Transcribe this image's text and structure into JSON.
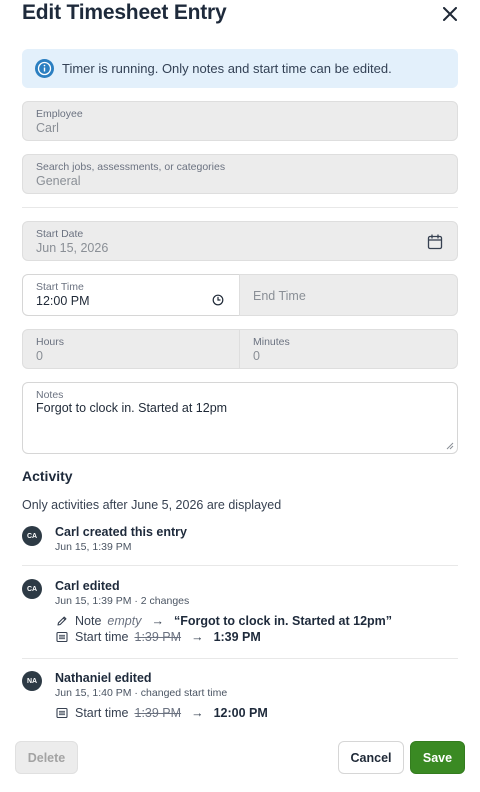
{
  "dialog": {
    "title": "Edit Timesheet Entry"
  },
  "banner": {
    "text": "Timer is running. Only notes and start time can be edited."
  },
  "employee": {
    "label": "Employee",
    "value": "Carl"
  },
  "job": {
    "label": "Search jobs, assessments, or categories",
    "value": "General"
  },
  "start_date": {
    "label": "Start Date",
    "value": "Jun 15, 2026"
  },
  "start_time": {
    "label": "Start Time",
    "value": "12:00 PM"
  },
  "end_time": {
    "placeholder": "End Time"
  },
  "hours": {
    "label": "Hours",
    "value": "0"
  },
  "minutes": {
    "label": "Minutes",
    "value": "0"
  },
  "notes": {
    "label": "Notes",
    "value": "Forgot to clock in. Started at 12pm"
  },
  "activity": {
    "title": "Activity",
    "info": "Only activities after June 5, 2026 are displayed",
    "items": [
      {
        "initials": "CA",
        "title": "Carl created this entry",
        "meta": "Jun 15, 1:39 PM"
      },
      {
        "initials": "CA",
        "title": "Carl edited",
        "meta": "Jun 15, 1:39 PM · 2 changes",
        "changes": [
          {
            "icon": "pencil-icon",
            "field": "Note",
            "old": "empty",
            "arrow": "→",
            "new": "“Forgot to clock in. Started at 12pm”"
          },
          {
            "icon": "list-icon",
            "field": "Start time",
            "old": "1:39 PM",
            "arrow": "→",
            "new": "1:39 PM"
          }
        ]
      },
      {
        "initials": "NA",
        "title": "Nathaniel edited",
        "meta": "Jun 15, 1:40 PM · changed start time",
        "changes": [
          {
            "icon": "list-icon",
            "field": "Start time",
            "old": "1:39 PM",
            "arrow": "→",
            "new": "12:00 PM"
          }
        ]
      }
    ]
  },
  "footer": {
    "delete_label": "Delete",
    "cancel_label": "Cancel",
    "save_label": "Save"
  },
  "colors": {
    "save": "#3a8a23",
    "banner_bg": "#e3f0fb",
    "info_icon": "#2b7fc1",
    "avatar": "#2d3a45"
  }
}
